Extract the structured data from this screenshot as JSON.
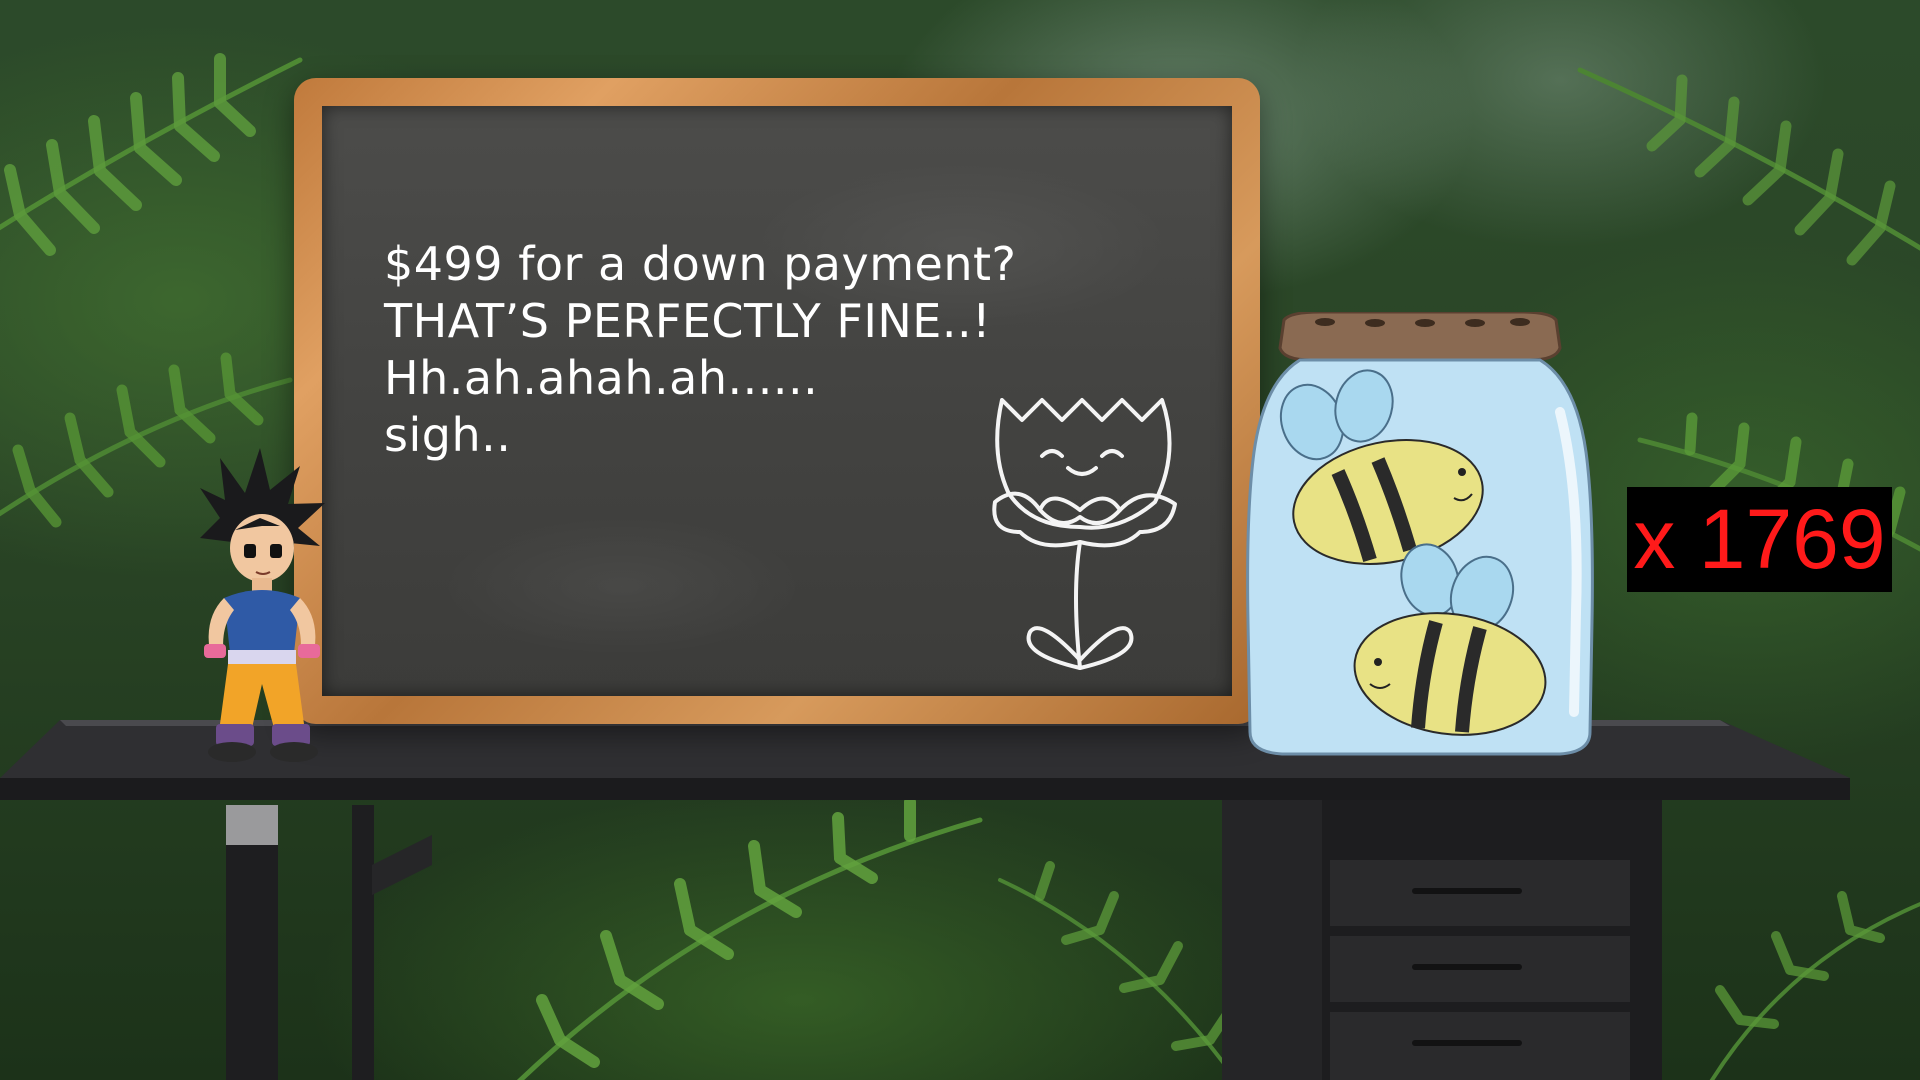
{
  "board": {
    "lines": [
      "$499 for a down payment?",
      "THAT’S PERFECTLY FINE..!",
      "Hh.ah.ahah.ah......",
      "sigh.."
    ]
  },
  "counter": {
    "text": "x 1769",
    "color": "#ff1a1a",
    "background": "#000000"
  },
  "icons": {
    "character": "cartoon-boy-figure-icon",
    "flower": "chalk-flower-icon",
    "jar": "bee-jar-icon"
  }
}
